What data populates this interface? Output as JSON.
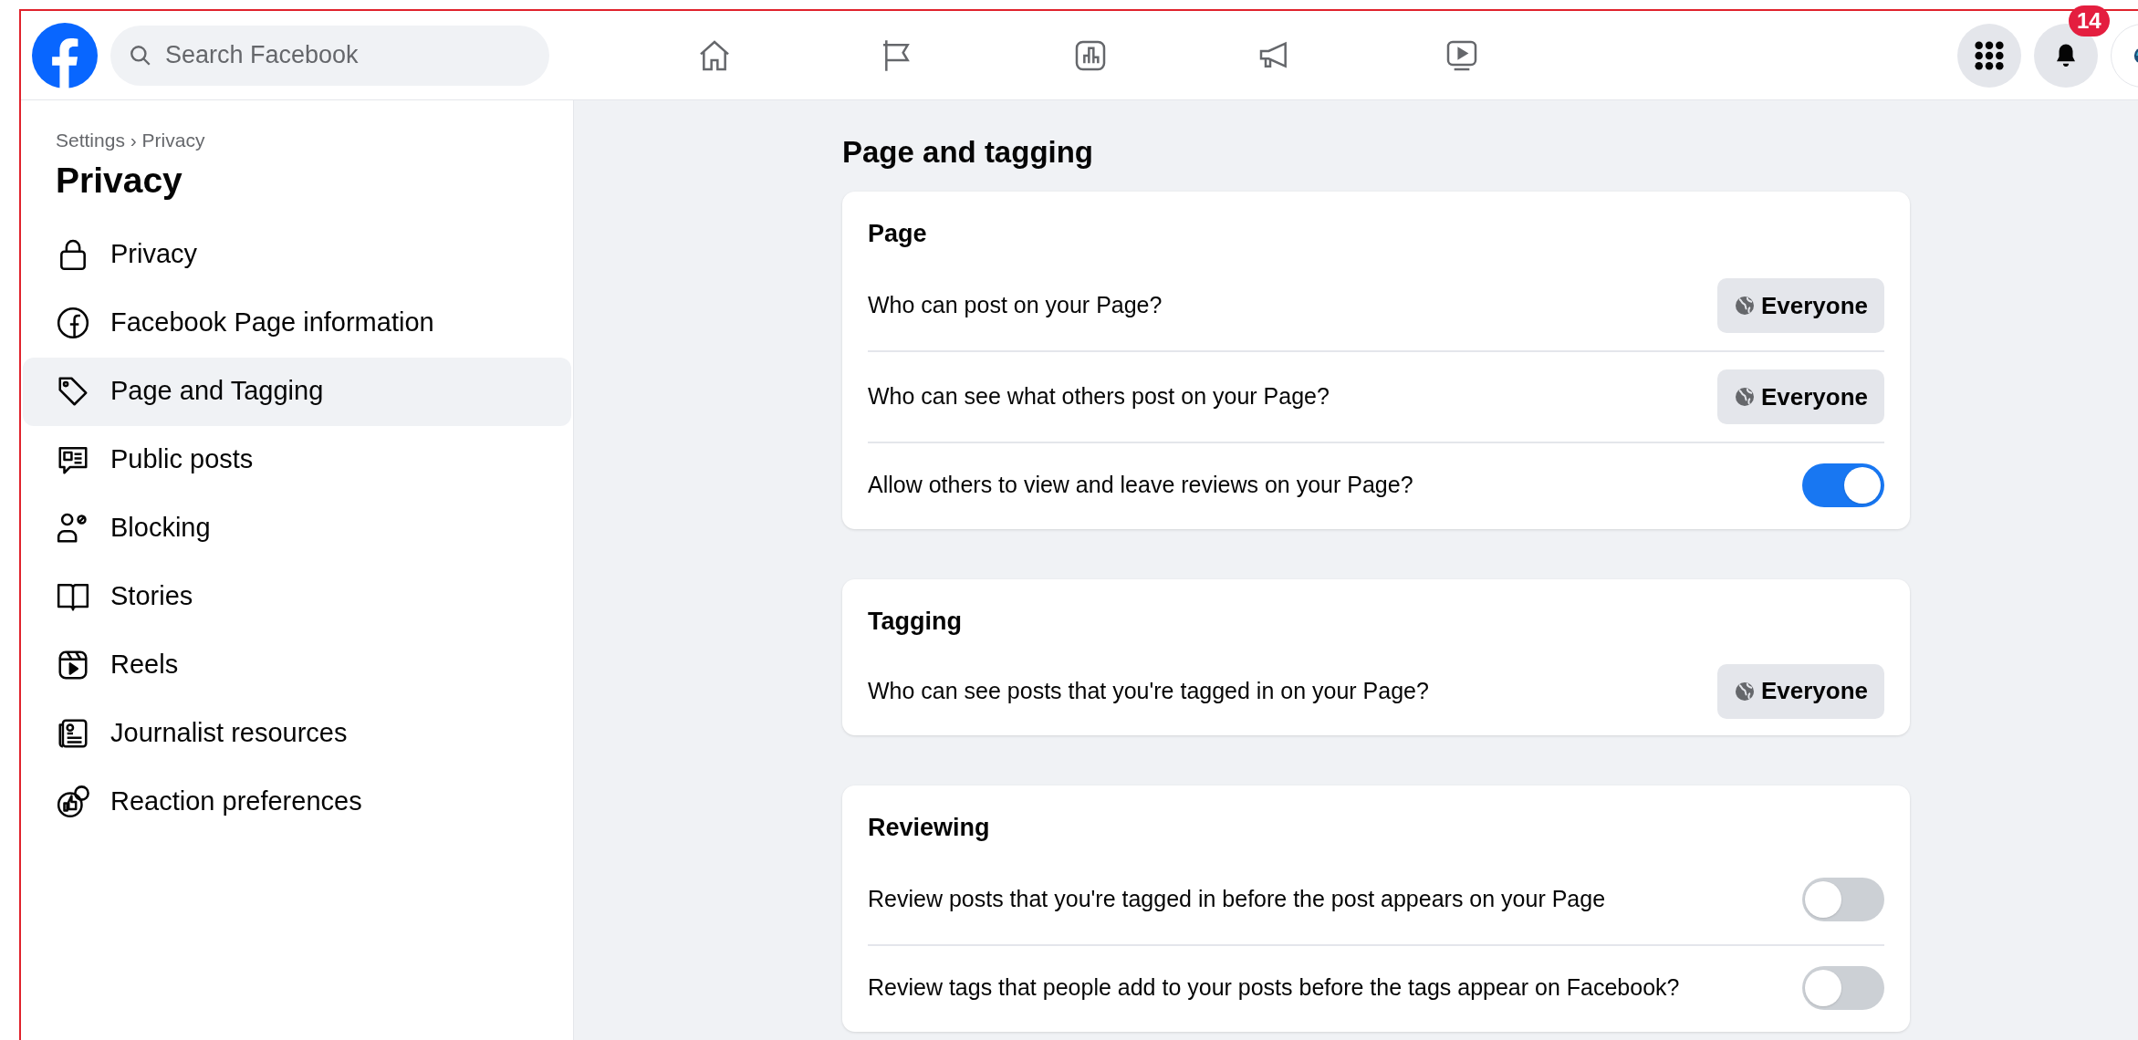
{
  "search": {
    "placeholder": "Search Facebook"
  },
  "notifications": {
    "badge": "14"
  },
  "sidebar": {
    "breadcrumb": "Settings › Privacy",
    "title": "Privacy",
    "items": [
      {
        "label": "Privacy",
        "selected": false
      },
      {
        "label": "Facebook Page information",
        "selected": false
      },
      {
        "label": "Page and Tagging",
        "selected": true
      },
      {
        "label": "Public posts",
        "selected": false
      },
      {
        "label": "Blocking",
        "selected": false
      },
      {
        "label": "Stories",
        "selected": false
      },
      {
        "label": "Reels",
        "selected": false
      },
      {
        "label": "Journalist resources",
        "selected": false
      },
      {
        "label": "Reaction preferences",
        "selected": false
      }
    ]
  },
  "main": {
    "heading": "Page and tagging",
    "sections": [
      {
        "title": "Page",
        "rows": [
          {
            "kind": "audience",
            "label": "Who can post on your Page?",
            "value": "Everyone"
          },
          {
            "kind": "audience",
            "label": "Who can see what others post on your Page?",
            "value": "Everyone"
          },
          {
            "kind": "toggle",
            "label": "Allow others to view and leave reviews on your Page?",
            "on": true
          }
        ]
      },
      {
        "title": "Tagging",
        "rows": [
          {
            "kind": "audience",
            "label": "Who can see posts that you're tagged in on your Page?",
            "value": "Everyone"
          }
        ]
      },
      {
        "title": "Reviewing",
        "rows": [
          {
            "kind": "toggle",
            "label": "Review posts that you're tagged in before the post appears on your Page",
            "on": false
          },
          {
            "kind": "toggle",
            "label": "Review tags that people add to your posts before the tags appear on Facebook?",
            "on": false
          }
        ]
      }
    ]
  }
}
